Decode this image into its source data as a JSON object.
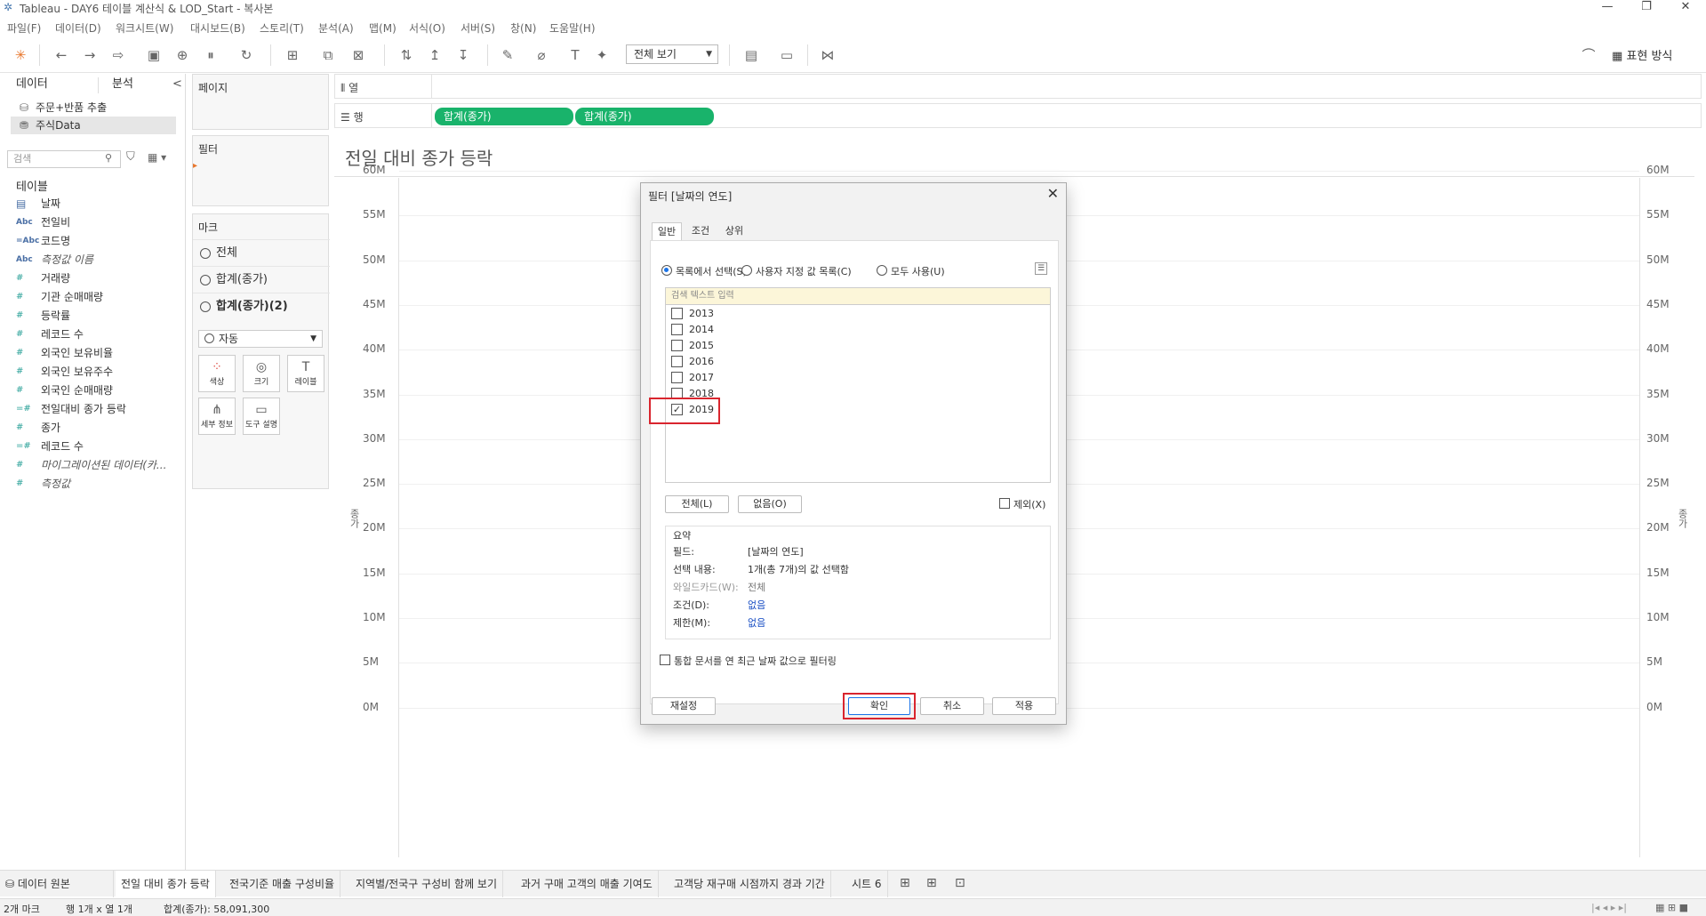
{
  "window": {
    "title": "Tableau - DAY6 테이블 계산식 & LOD_Start - 복사본",
    "controls": [
      "—",
      "❐",
      "✕"
    ]
  },
  "menu": [
    "파일(F)",
    "데이터(D)",
    "워크시트(W)",
    "대시보드(B)",
    "스토리(T)",
    "분석(A)",
    "맵(M)",
    "서식(O)",
    "서버(S)",
    "창(N)",
    "도움말(H)"
  ],
  "toolbar": {
    "view_select": "전체 보기",
    "show_me": "표현 방식"
  },
  "data_pane": {
    "tabs": [
      "데이터",
      "분석"
    ],
    "collapse": "<",
    "sources": [
      "주문+반품 추출",
      "주식Data"
    ],
    "search_placeholder": "검색",
    "tables_header": "테이블",
    "fields": [
      {
        "icon": "cal",
        "name": "날짜",
        "italic": false
      },
      {
        "icon": "Abc",
        "name": "전일비",
        "italic": false
      },
      {
        "icon": "=Abc",
        "name": "코드명",
        "italic": false
      },
      {
        "icon": "Abc",
        "name": "측정값 이름",
        "italic": true
      },
      {
        "icon": "#",
        "name": "거래량",
        "italic": false
      },
      {
        "icon": "#",
        "name": "기관 순매매량",
        "italic": false
      },
      {
        "icon": "#",
        "name": "등락률",
        "italic": false
      },
      {
        "icon": "#",
        "name": "레코드 수",
        "italic": false
      },
      {
        "icon": "#",
        "name": "외국인 보유비율",
        "italic": false
      },
      {
        "icon": "#",
        "name": "외국인 보유주수",
        "italic": false
      },
      {
        "icon": "#",
        "name": "외국인 순매매량",
        "italic": false
      },
      {
        "icon": "=#",
        "name": "전일대비 종가 등락",
        "italic": false
      },
      {
        "icon": "#",
        "name": "종가",
        "italic": false
      },
      {
        "icon": "=#",
        "name": "레코드 수",
        "italic": false
      },
      {
        "icon": "#",
        "name": "마이그레이션된 데이터(카...",
        "italic": true
      },
      {
        "icon": "#",
        "name": "측정값",
        "italic": true
      }
    ]
  },
  "cards": {
    "pages": "페이지",
    "filters": "필터",
    "marks": "마크",
    "mark_rows": [
      "전체",
      "합계(종가)",
      "합계(종가)(2)"
    ],
    "mark_type": "자동",
    "mark_buttons": [
      "색상",
      "크기",
      "레이블",
      "세부 정보",
      "도구 설명"
    ]
  },
  "shelves": {
    "columns_label": "열",
    "rows_label": "행",
    "row_pills": [
      "합계(종가)",
      "합계(종가)"
    ]
  },
  "view": {
    "title": "전일 대비 종가 등락",
    "y_ticks": [
      "60M",
      "55M",
      "50M",
      "45M",
      "40M",
      "35M",
      "30M",
      "25M",
      "20M",
      "15M",
      "10M",
      "5M",
      "0M"
    ],
    "y_axis_label": "종가"
  },
  "dialog": {
    "title": "필터 [날짜의 연도]",
    "close": "✕",
    "tabs": [
      "일반",
      "조건",
      "상위"
    ],
    "radio_options": [
      "목록에서 선택(S)",
      "사용자 지정 값 목록(C)",
      "모두 사용(U)"
    ],
    "search_placeholder": "검색 텍스트 입력",
    "years": [
      {
        "label": "2013",
        "checked": false
      },
      {
        "label": "2014",
        "checked": false
      },
      {
        "label": "2015",
        "checked": false
      },
      {
        "label": "2016",
        "checked": false
      },
      {
        "label": "2017",
        "checked": false
      },
      {
        "label": "2018",
        "checked": false
      },
      {
        "label": "2019",
        "checked": true
      }
    ],
    "btn_all": "전체(L)",
    "btn_none": "없음(O)",
    "exclude": "제외(X)",
    "summary_header": "요약",
    "summary": {
      "field_k": "필드:",
      "field_v": "[날짜의 연도]",
      "sel_k": "선택 내용:",
      "sel_v": "1개(총 7개)의 값 선택함",
      "wild_k": "와일드카드(W):",
      "wild_v": "전체",
      "cond_k": "조건(D):",
      "cond_v": "없음",
      "limit_k": "제한(M):",
      "limit_v": "없음"
    },
    "latest_date": "통합 문서를 연 최근 날짜 값으로 필터링",
    "btn_reset": "재설정",
    "btn_ok": "확인",
    "btn_cancel": "취소",
    "btn_apply": "적용"
  },
  "sheet_tabs": [
    "데이터 원본",
    "전일 대비 종가 등락",
    "전국기준 매출 구성비율",
    "지역별/전국구 구성비 함께 보기",
    "과거 구매 고객의 매출 기여도",
    "고객당 재구매 시점까지 경과 기간",
    "시트 6"
  ],
  "status": {
    "marks": "2개 마크",
    "rows_cols": "행 1개 x 열 1개",
    "sum": "합계(종가): 58,091,300"
  },
  "colors": {
    "pill": "#19b36b",
    "highlight": "#d9252e",
    "link": "#1a4fc4"
  }
}
